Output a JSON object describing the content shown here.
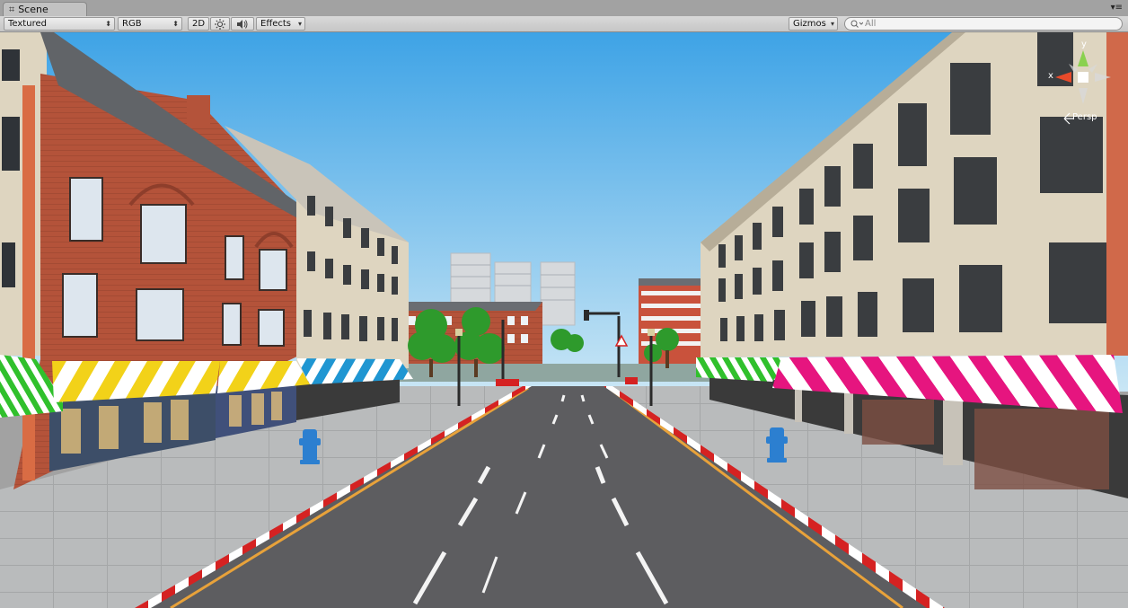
{
  "tab": {
    "title": "Scene",
    "grid_icon": "⌗",
    "menu_glyph": "▾≡"
  },
  "toolbar": {
    "draw_mode": "Textured",
    "render_mode": "RGB",
    "mode_2d": "2D",
    "effects": "Effects",
    "gizmos": "Gizmos",
    "search_placeholder": "All",
    "dropdown_arrow": "⬍",
    "small_arrow": "▾"
  },
  "gizmo": {
    "x": "x",
    "y": "y",
    "persp": "Persp"
  },
  "colors": {
    "sky_top": "#3ea3e6",
    "sky_bottom": "#c9e6f5",
    "road": "#5d5d60",
    "sidewalk": "#b9bbbc",
    "brick": "#b4533a",
    "cream": "#ded5c0",
    "awning_yellow": "#f2d219",
    "awning_blue": "#1f96d2",
    "awning_green": "#30c02c",
    "awning_pink": "#e6157f"
  }
}
